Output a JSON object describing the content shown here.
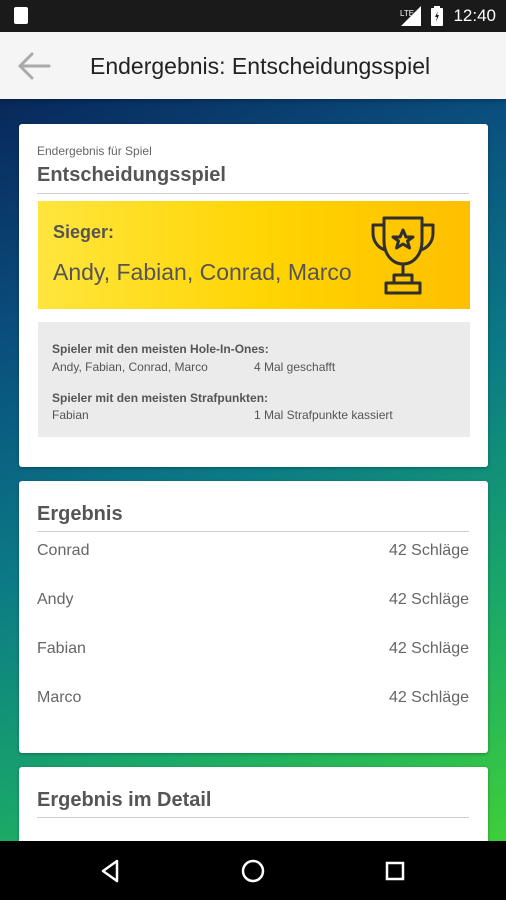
{
  "status_bar": {
    "network": "LTE",
    "time": "12:40"
  },
  "app_bar": {
    "title": "Endergebnis: Entscheidungsspiel",
    "back_icon": "arrow-left-icon"
  },
  "summary": {
    "label": "Endergebnis für Spiel",
    "game_name": "Entscheidungsspiel",
    "winner_label": "Sieger:",
    "winner_names": "Andy, Fabian, Conrad, Marco",
    "trophy_icon": "trophy-icon",
    "stats": [
      {
        "title": "Spieler mit den meisten Hole-In-Ones:",
        "players": "Andy, Fabian, Conrad, Marco",
        "value": "4 Mal geschafft"
      },
      {
        "title": "Spieler mit den meisten Strafpunkten:",
        "players": "Fabian",
        "value": "1 Mal Strafpunkte kassiert"
      }
    ]
  },
  "results": {
    "title": "Ergebnis",
    "rows": [
      {
        "name": "Conrad",
        "score": "42 Schläge"
      },
      {
        "name": "Andy",
        "score": "42 Schläge"
      },
      {
        "name": "Fabian",
        "score": "42 Schläge"
      },
      {
        "name": "Marco",
        "score": "42 Schläge"
      }
    ]
  },
  "detail": {
    "title": "Ergebnis im Detail"
  },
  "colors": {
    "winner_yellow": "#ffd400",
    "gradient_top": "#08285a",
    "gradient_bottom": "#3fcf3a"
  }
}
